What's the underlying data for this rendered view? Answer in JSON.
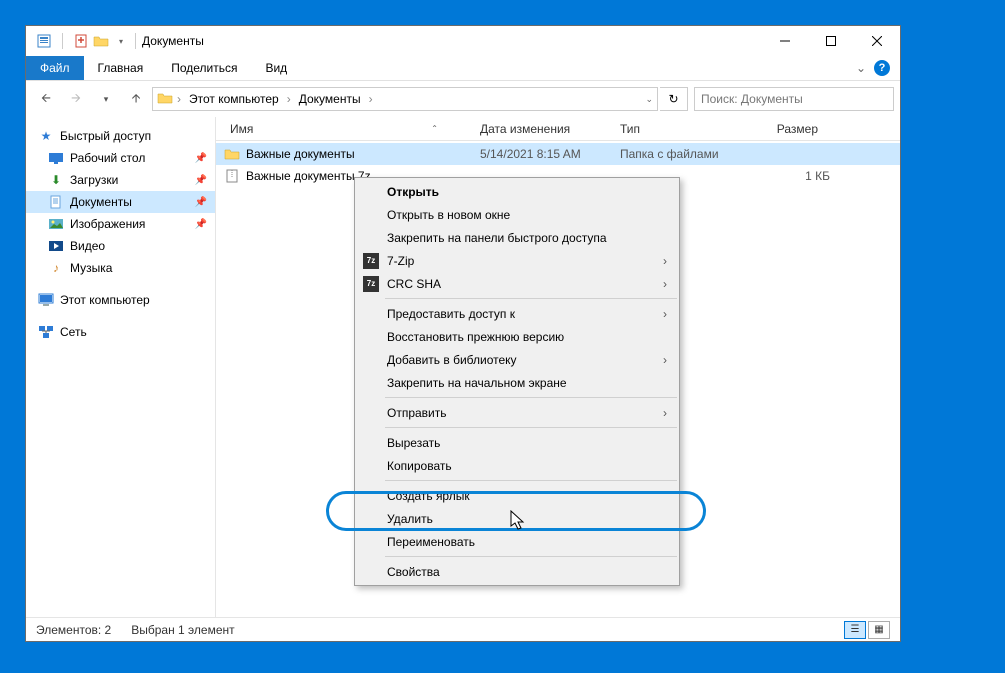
{
  "titlebar": {
    "title": "Документы"
  },
  "ribbon": {
    "file": "Файл",
    "home": "Главная",
    "share": "Поделиться",
    "view": "Вид"
  },
  "address": {
    "crumb1": "Этот компьютер",
    "crumb2": "Документы",
    "refresh_tooltip": "Обновить"
  },
  "search": {
    "placeholder": "Поиск: Документы"
  },
  "sidebar": {
    "quick_access": "Быстрый доступ",
    "desktop": "Рабочий стол",
    "downloads": "Загрузки",
    "documents": "Документы",
    "pictures": "Изображения",
    "videos": "Видео",
    "music": "Музыка",
    "this_pc": "Этот компьютер",
    "network": "Сеть"
  },
  "columns": {
    "name": "Имя",
    "date": "Дата изменения",
    "type": "Тип",
    "size": "Размер"
  },
  "files": [
    {
      "name": "Важные документы",
      "date": "5/14/2021 8:15 AM",
      "type": "Папка с файлами",
      "size": ""
    },
    {
      "name": "Важные документы.7z",
      "date": "",
      "type": "",
      "size": "1 КБ"
    }
  ],
  "status": {
    "count": "Элементов: 2",
    "selection": "Выбран 1 элемент"
  },
  "context_menu": {
    "open": "Открыть",
    "open_new_window": "Открыть в новом окне",
    "pin_quick_access": "Закрепить на панели быстрого доступа",
    "seven_zip": "7-Zip",
    "crc_sha": "CRC SHA",
    "give_access": "Предоставить доступ к",
    "restore_previous": "Восстановить прежнюю версию",
    "add_to_library": "Добавить в библиотеку",
    "pin_start": "Закрепить на начальном экране",
    "send_to": "Отправить",
    "cut": "Вырезать",
    "copy": "Копировать",
    "create_shortcut": "Создать ярлык",
    "delete": "Удалить",
    "rename": "Переименовать",
    "properties": "Свойства"
  }
}
